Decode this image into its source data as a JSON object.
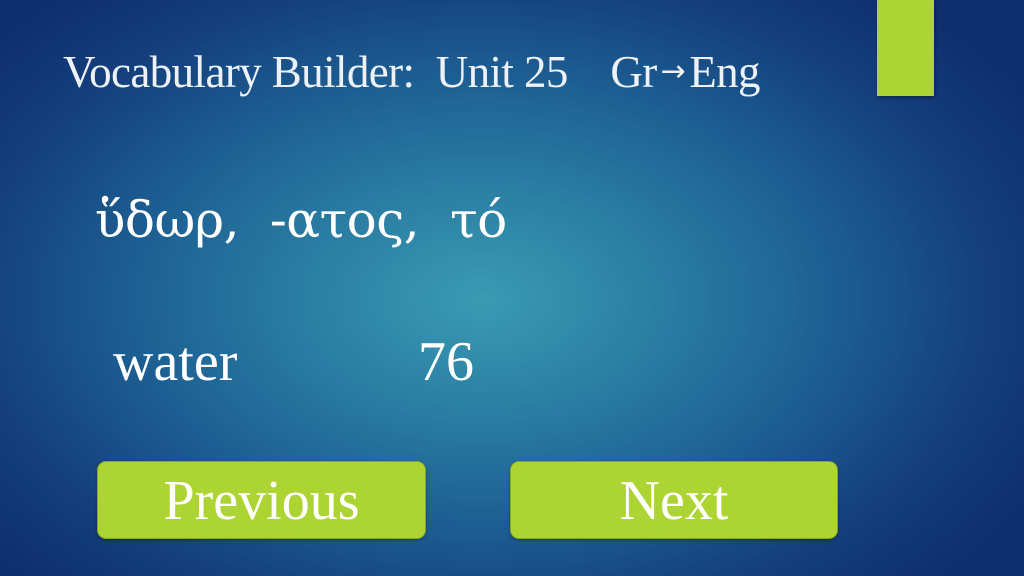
{
  "header": {
    "title_prefix": "Vocabulary Builder:  Unit 25    Gr",
    "arrow_icon": "→",
    "title_suffix": "Eng"
  },
  "card": {
    "greek_entry": "ὕδωρ,  -ατος,  τό",
    "english_meaning": "water",
    "frequency_count": "76"
  },
  "navigation": {
    "previous_label": "Previous",
    "next_label": "Next"
  },
  "colors": {
    "accent_green": "#acd433",
    "background_dark_blue": "#0f2e6e",
    "background_center_teal": "#3a9bb3",
    "text": "#ffffff"
  }
}
